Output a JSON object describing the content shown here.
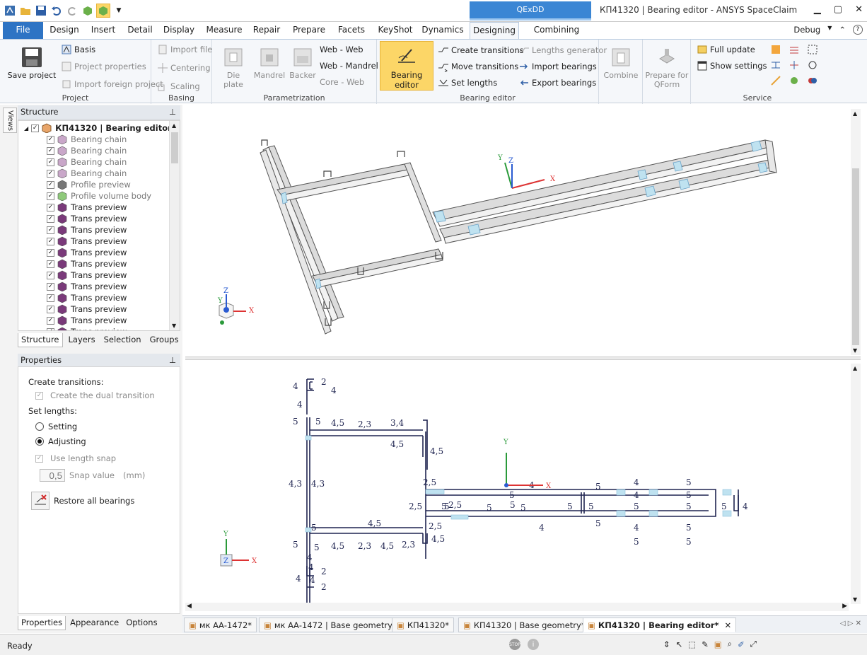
{
  "window": {
    "title": "КП41320 | Bearing editor - ANSYS SpaceClaim",
    "context_tab": "QExDD"
  },
  "menu_tabs": [
    "File",
    "Design",
    "Insert",
    "Detail",
    "Display",
    "Measure",
    "Repair",
    "Prepare",
    "Facets",
    "KeyShot",
    "Dynamics",
    "Designing",
    "Combining tools"
  ],
  "menu_right": "Debug",
  "ribbon": {
    "project": {
      "label": "Project",
      "save": "Save project",
      "basis": "Basis",
      "project_properties": "Project properties",
      "import_foreign": "Import foreign project"
    },
    "basing": {
      "label": "Basing",
      "import_file": "Import file",
      "centering": "Centering",
      "scaling": "Scaling"
    },
    "parametrization": {
      "label": "Parametrization",
      "die_plate": "Die plate",
      "mandrel": "Mandrel",
      "backer": "Backer",
      "web_web": "Web - Web",
      "web_mandrel": "Web - Mandrel",
      "core_web": "Core - Web"
    },
    "bearing_editor": {
      "label": "Bearing editor",
      "bearing_editor_btn": "Bearing editor",
      "create_transitions": "Create transitions",
      "move_transitions": "Move transitions",
      "set_lengths": "Set lengths",
      "lengths_generator": "Lengths generator",
      "import_bearings": "Import bearings",
      "export_bearings": "Export bearings"
    },
    "combine": {
      "label": "Combine"
    },
    "qform": {
      "label": "Prepare for QForm"
    },
    "service": {
      "label": "Service",
      "full_update": "Full update",
      "show_settings": "Show settings"
    }
  },
  "structure": {
    "title": "Structure",
    "root": "КП41320 | Bearing editor",
    "items": [
      "Bearing chain",
      "Bearing chain",
      "Bearing chain",
      "Bearing chain",
      "Profile preview",
      "Profile volume body",
      "Trans preview",
      "Trans preview",
      "Trans preview",
      "Trans preview",
      "Trans preview",
      "Trans preview",
      "Trans preview",
      "Trans preview",
      "Trans preview",
      "Trans preview",
      "Trans preview",
      "Trans preview"
    ],
    "tabs": [
      "Structure",
      "Layers",
      "Selection",
      "Groups"
    ]
  },
  "views_tab": "Views",
  "properties": {
    "title": "Properties",
    "create_transitions": "Create transitions:",
    "dual_transition": "Create the dual transition",
    "set_lengths": "Set lengths:",
    "setting": "Setting",
    "adjusting": "Adjusting",
    "use_snap": "Use length snap",
    "snap_value": "0,5",
    "snap_label": "Snap value",
    "snap_unit": "(mm)",
    "restore": "Restore all bearings",
    "tabs": [
      "Properties",
      "Appearance",
      "Options"
    ]
  },
  "axes": {
    "x": "X",
    "y": "Y",
    "z": "Z"
  },
  "dims": [
    {
      "t": "4"
    },
    {
      "t": "2"
    },
    {
      "t": "4"
    },
    {
      "t": "4"
    },
    {
      "t": "5"
    },
    {
      "t": "5"
    },
    {
      "t": "4,5"
    },
    {
      "t": "2,3"
    },
    {
      "t": "3,4"
    },
    {
      "t": "4,5"
    },
    {
      "t": "4,5"
    },
    {
      "t": "4,3"
    },
    {
      "t": "4,3"
    },
    {
      "t": "2,5"
    },
    {
      "t": "2,5"
    },
    {
      "t": "5"
    },
    {
      "t": "2,5"
    },
    {
      "t": "2,5"
    },
    {
      "t": "4,5"
    },
    {
      "t": "5"
    },
    {
      "t": "5"
    },
    {
      "t": "5"
    },
    {
      "t": "4,5"
    },
    {
      "t": "4,5"
    },
    {
      "t": "2,3"
    },
    {
      "t": "4,5"
    },
    {
      "t": "2,3"
    },
    {
      "t": "4"
    },
    {
      "t": "4"
    },
    {
      "t": "2"
    },
    {
      "t": "4"
    },
    {
      "t": "4"
    },
    {
      "t": "2"
    },
    {
      "t": "4"
    },
    {
      "t": "5"
    },
    {
      "t": "5"
    },
    {
      "t": "5"
    },
    {
      "t": "5"
    },
    {
      "t": "5"
    },
    {
      "t": "4"
    },
    {
      "t": "5"
    },
    {
      "t": "5"
    },
    {
      "t": "4"
    },
    {
      "t": "5"
    },
    {
      "t": "5"
    },
    {
      "t": "4"
    },
    {
      "t": "5"
    },
    {
      "t": "5"
    },
    {
      "t": "5"
    },
    {
      "t": "4"
    },
    {
      "t": "5"
    },
    {
      "t": "5"
    },
    {
      "t": "4"
    },
    {
      "t": "5"
    },
    {
      "t": "5"
    },
    {
      "t": "5"
    }
  ],
  "doc_tabs": [
    "мк АА-1472*",
    "мк АА-1472 | Base geometry*",
    "КП41320*",
    "КП41320 | Base geometry*",
    "КП41320 | Bearing editor*"
  ],
  "status": {
    "text": "Ready"
  }
}
